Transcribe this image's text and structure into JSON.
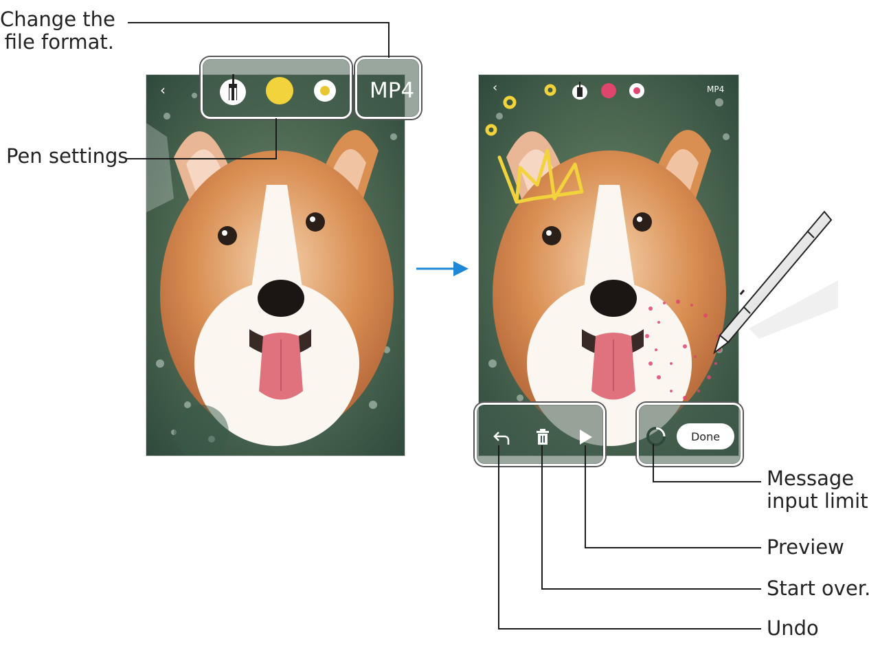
{
  "callouts": {
    "file_format": [
      "Change the",
      "file format."
    ],
    "pen_settings": "Pen settings",
    "message_limit": [
      "Message",
      "input limit"
    ],
    "preview": "Preview",
    "start_over": "Start over.",
    "undo": "Undo"
  },
  "left_screen": {
    "back_icon": "chevron-left-icon",
    "toolbar": {
      "pen_icon": "pen-icon",
      "color": "#F2D33C",
      "size_icon": "pen-size-icon"
    },
    "format_button": "MP4"
  },
  "right_screen": {
    "back_icon": "chevron-left-icon",
    "toolbar": {
      "pen_icon": "pen-icon",
      "color": "#E0456E",
      "size_icon": "pen-size-icon"
    },
    "format_button": "MP4",
    "bottom_bar": {
      "undo_icon": "undo-icon",
      "delete_icon": "trash-icon",
      "play_icon": "play-icon",
      "limit_icon": "progress-ring-icon",
      "done_label": "Done"
    }
  },
  "colors": {
    "accent_arrow": "#1E88D8",
    "leader": "#1a1a1a"
  }
}
